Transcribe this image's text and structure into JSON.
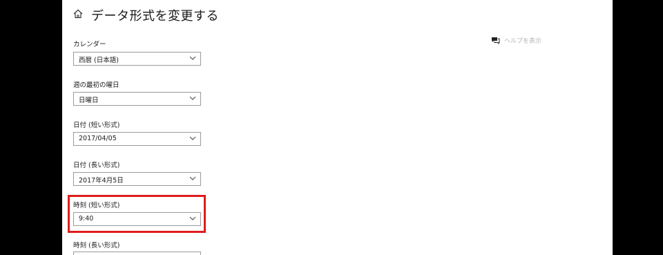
{
  "header": {
    "title": "データ形式を変更する",
    "home_icon": "home-icon"
  },
  "help": {
    "label": "ヘルプを表示",
    "icon": "chat-help-icon"
  },
  "fields": [
    {
      "label": "カレンダー",
      "value": "西暦 (日本語)"
    },
    {
      "label": "週の最初の曜日",
      "value": "日曜日"
    },
    {
      "label": "日付 (短い形式)",
      "value": "2017/04/05"
    },
    {
      "label": "日付 (長い形式)",
      "value": "2017年4月5日"
    },
    {
      "label": "時刻 (短い形式)",
      "value": "9:40"
    },
    {
      "label": "時刻 (長い形式)",
      "value": ""
    }
  ],
  "colors": {
    "highlight": "#e01b1b",
    "background": "#000000",
    "panel": "#ffffff"
  }
}
